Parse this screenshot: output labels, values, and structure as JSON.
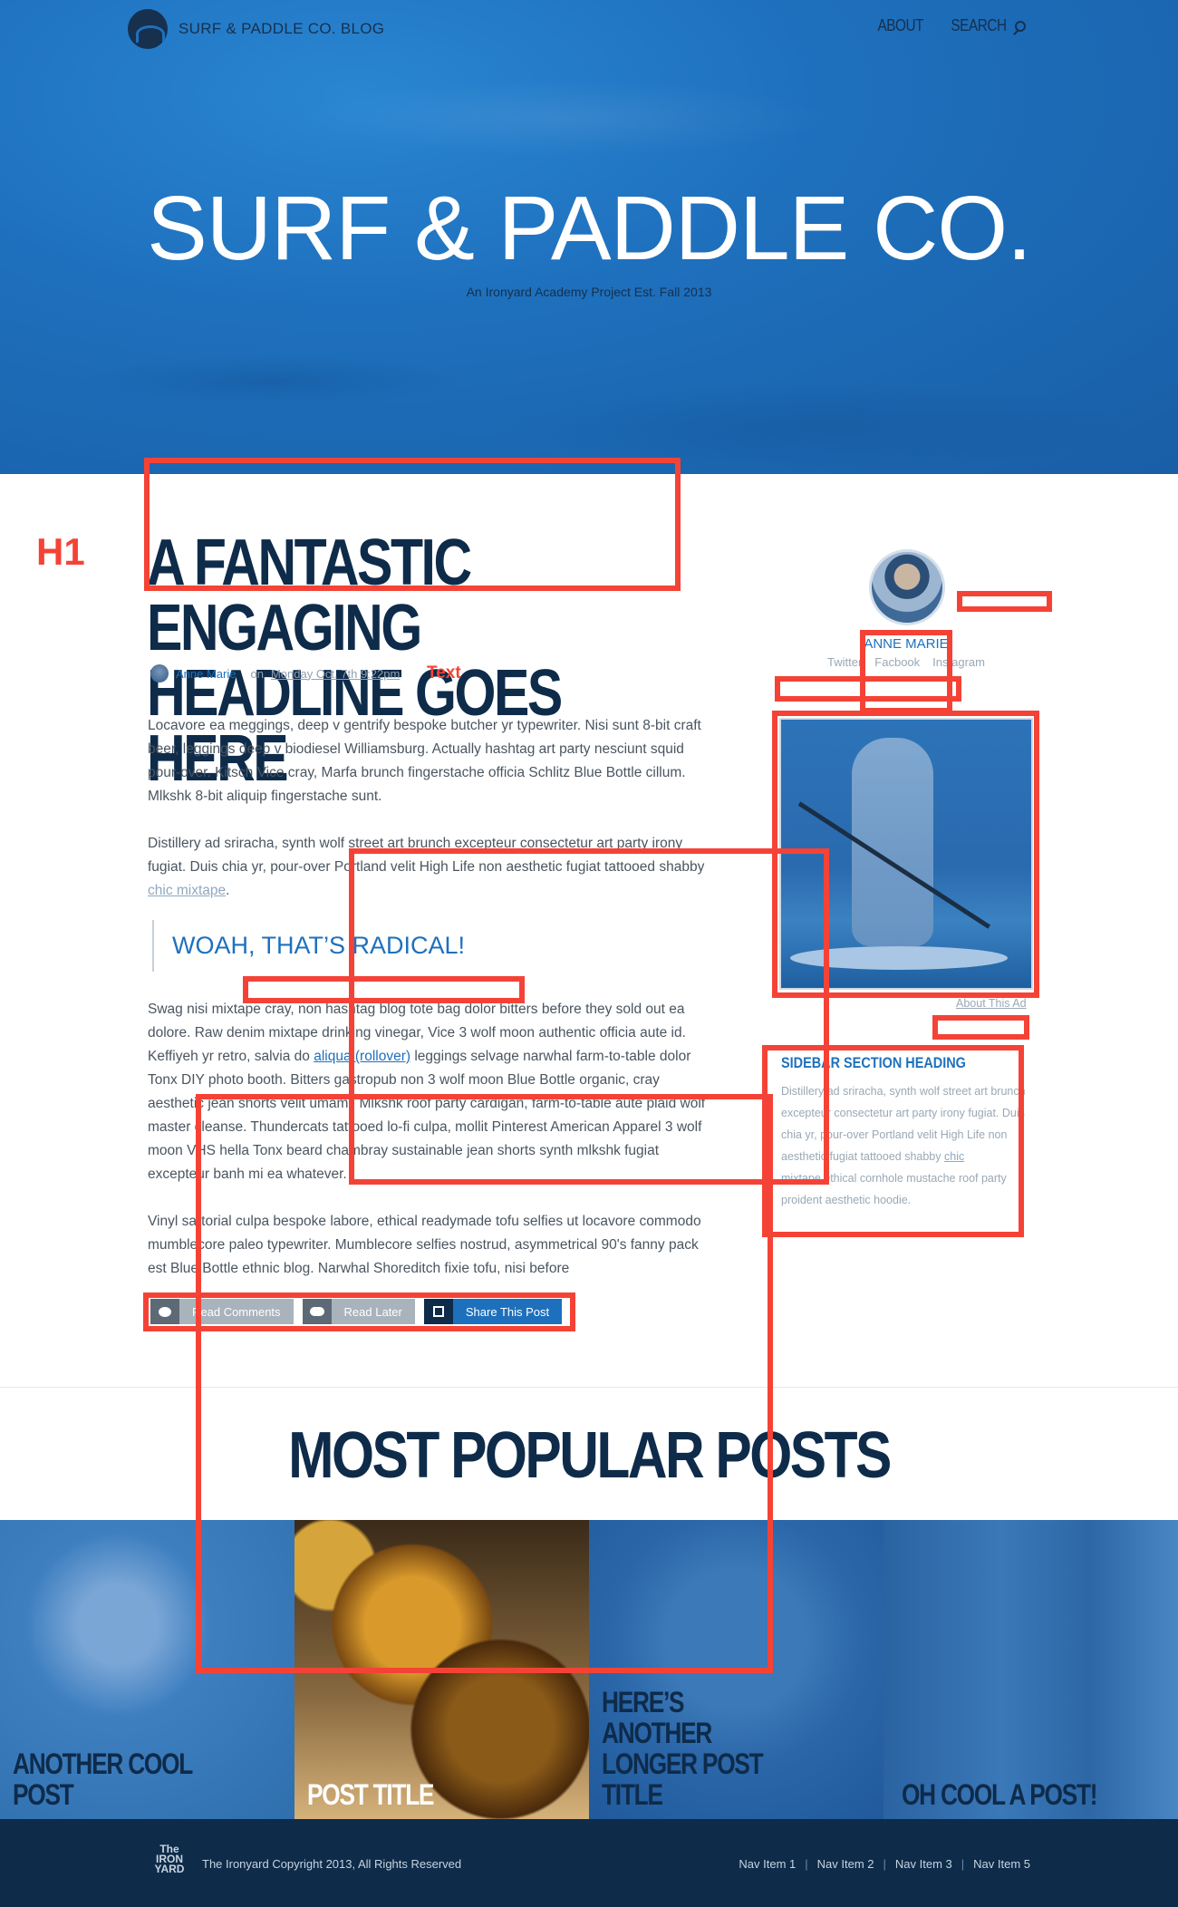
{
  "header": {
    "logo_text": "SURF & PADDLE CO. BLOG",
    "nav": {
      "about": "ABOUT",
      "search": "SEARCH"
    },
    "title": "SURF & PADDLE CO.",
    "subtitle": "An Ironyard Academy Project Est. Fall 2013"
  },
  "annotations": {
    "h1_label": "H1",
    "text_label": "Text"
  },
  "article": {
    "headline_line1": "A FANTASTIC ENGAGING",
    "headline_line2": "HEADLINE GOES HERE",
    "author": "Anne Marie",
    "on": "on",
    "date": "Monday Oct. 7th 9:22pm",
    "p1": "Locavore ea meggings, deep v gentrify bespoke butcher yr typewriter. Nisi sunt 8-bit craft beer, leggings deep v biodiesel Williamsburg. Actually hashtag art party nesciunt squid pour-over. Kitsch Vice cray, Marfa brunch fingerstache officia Schlitz Blue Bottle cillum. Mlkshk 8-bit aliquip fingerstache sunt.",
    "p2_text": "Distillery ad sriracha, synth wolf street art brunch excepteur consectetur art party irony fugiat. Duis chia yr, pour-over Portland velit High Life non aesthetic fugiat tattooed shabby ",
    "p2_link": "chic mixtape",
    "p2_end": ".",
    "pullquote": "WOAH, THAT’S RADICAL!",
    "p3_a": "Swag nisi mixtape cray, non hashtag blog tote bag dolor bitters before they sold out ea dolore. Raw denim mixtape drinking vinegar, Vice 3 wolf moon authentic officia aute id. Keffiyeh yr retro, salvia do ",
    "p3_link": "aliqua (rollover)",
    "p3_b": " leggings selvage narwhal farm-to-table dolor Tonx DIY photo booth. Bitters gastropub non 3 wolf moon Blue Bottle organic, cray aesthetic jean shorts velit umami. Mlkshk roof party cardigan, farm-to-table aute plaid wolf master cleanse. Thundercats tattooed lo-fi culpa, mollit Pinterest American Apparel 3 wolf moon VHS hella Tonx beard chambray sustainable jean shorts synth mlkshk fugiat excepteur banh mi ea whatever.",
    "p4": "Vinyl sartorial culpa bespoke labore, ethical readymade tofu selfies ut locavore commodo mumblecore paleo typewriter. Mumblecore selfies nostrud, asymmetrical 90's fanny pack est Blue Bottle ethnic blog. Narwhal Shoreditch fixie tofu, nisi before",
    "actions": {
      "read_comments": "Read Comments",
      "read_later": "Read Later",
      "share": "Share This Post"
    }
  },
  "sidebar": {
    "name": "ANNE MARIE",
    "social": [
      "Twitter",
      "Facbook",
      "Instagram"
    ],
    "ad_link": "About This Ad",
    "section_heading": "SIDEBAR SECTION HEADING",
    "section_text": "Distillery ad sriracha, synth wolf street art brunch excepteur consectetur art party irony fugiat. Duis chia yr, pour-over Portland velit High Life non aesthetic fugiat tattooed shabby ",
    "section_link": "chic mixtape",
    "section_text_end": ",ethical cornhole mustache roof party proident aesthetic hoodie."
  },
  "popular": {
    "title": "MOST POPULAR POSTS",
    "posts": [
      "ANOTHER COOL POST",
      "POST TITLE",
      "HERE’S ANOTHER LONGER POST TITLE",
      "OH COOL A POST!"
    ]
  },
  "footer": {
    "logo": "The IRON YARD",
    "copyright": "The Ironyard Copyright 2013, All Rights Reserved",
    "nav": [
      "Nav Item 1",
      "Nav Item 2",
      "Nav Item 3",
      "Nav Item 5"
    ]
  },
  "colors": {
    "brand_blue": "#1e70bd",
    "navy": "#0e2b4a",
    "annotation_red": "#f44336"
  },
  "icons": [
    "logo-wave-icon",
    "search-icon",
    "comment-icon",
    "cloud-upload-icon",
    "share-icon"
  ]
}
